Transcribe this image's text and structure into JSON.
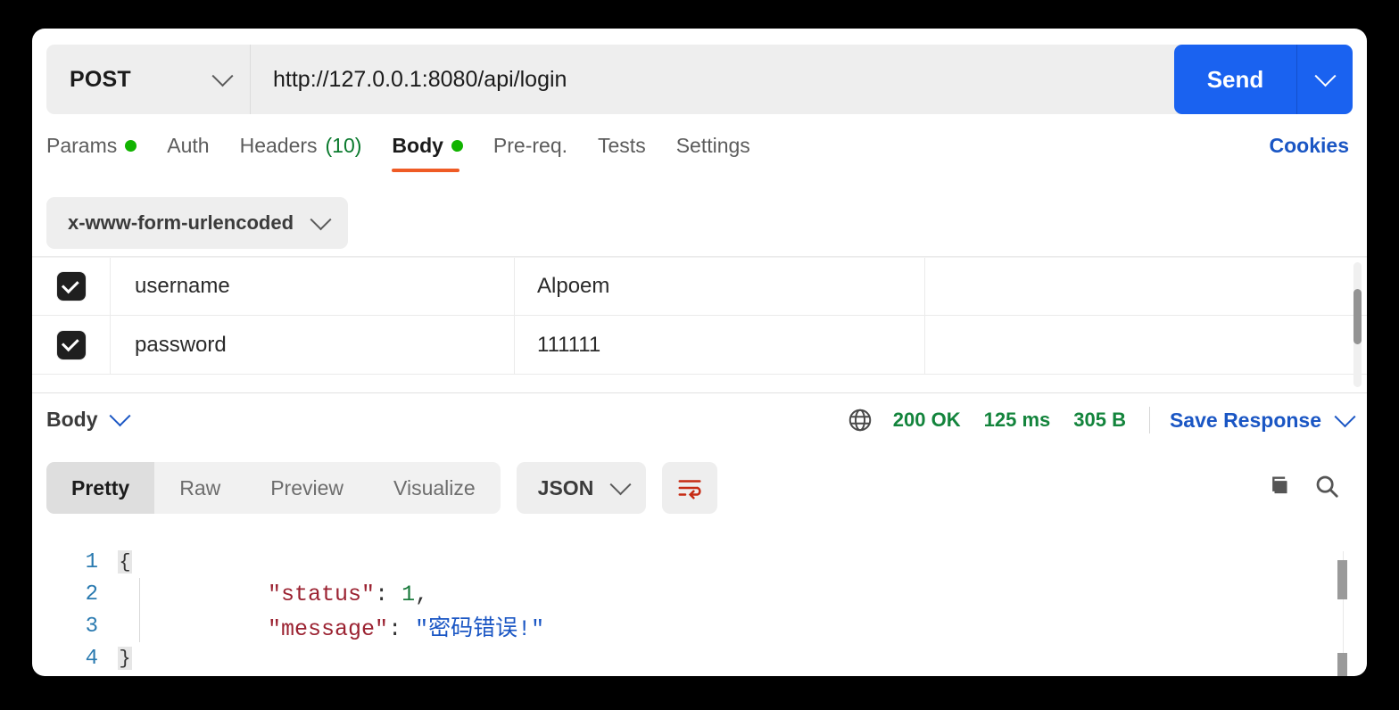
{
  "request": {
    "method": "POST",
    "url": "http://127.0.0.1:8080/api/login",
    "send_label": "Send",
    "tabs": [
      {
        "label": "Params",
        "marker": "dot",
        "active": false
      },
      {
        "label": "Auth",
        "marker": "",
        "active": false
      },
      {
        "label": "Headers",
        "marker": "(10)",
        "active": false
      },
      {
        "label": "Body",
        "marker": "dot",
        "active": true
      },
      {
        "label": "Pre-req.",
        "marker": "",
        "active": false
      },
      {
        "label": "Tests",
        "marker": "",
        "active": false
      },
      {
        "label": "Settings",
        "marker": "",
        "active": false
      }
    ],
    "cookies_label": "Cookies",
    "body_type": "x-www-form-urlencoded"
  },
  "params_table": {
    "rows": [
      {
        "enabled": true,
        "key": "username",
        "value": "Alpoem",
        "description": ""
      },
      {
        "enabled": true,
        "key": "password",
        "value": "111111",
        "description": ""
      }
    ]
  },
  "response": {
    "section_label": "Body",
    "status": "200 OK",
    "time": "125 ms",
    "size": "305 B",
    "save_label": "Save Response",
    "view_tabs": [
      {
        "label": "Pretty",
        "active": true
      },
      {
        "label": "Raw",
        "active": false
      },
      {
        "label": "Preview",
        "active": false
      },
      {
        "label": "Visualize",
        "active": false
      }
    ],
    "format": "JSON",
    "code_lines": [
      {
        "num": "1",
        "fold": true,
        "glyph": "{",
        "segments": []
      },
      {
        "num": "2",
        "fold": false,
        "glyph": "",
        "segments": [
          {
            "t": "    ",
            "c": "punc"
          },
          {
            "t": "\"status\"",
            "c": "k"
          },
          {
            "t": ": ",
            "c": "punc"
          },
          {
            "t": "1",
            "c": "num"
          },
          {
            "t": ",",
            "c": "punc"
          }
        ]
      },
      {
        "num": "3",
        "fold": false,
        "glyph": "",
        "segments": [
          {
            "t": "    ",
            "c": "punc"
          },
          {
            "t": "\"message\"",
            "c": "k"
          },
          {
            "t": ": ",
            "c": "punc"
          },
          {
            "t": "\"密码错误!\"",
            "c": "str"
          }
        ]
      },
      {
        "num": "4",
        "fold": true,
        "glyph": "}",
        "segments": []
      }
    ]
  },
  "colors": {
    "accent_blue": "#1a62f0",
    "link_blue": "#1a56c4",
    "success_green": "#13843c",
    "dot_green": "#11b300",
    "tab_underline": "#ef5b25",
    "wrap_icon": "#c62b14"
  }
}
